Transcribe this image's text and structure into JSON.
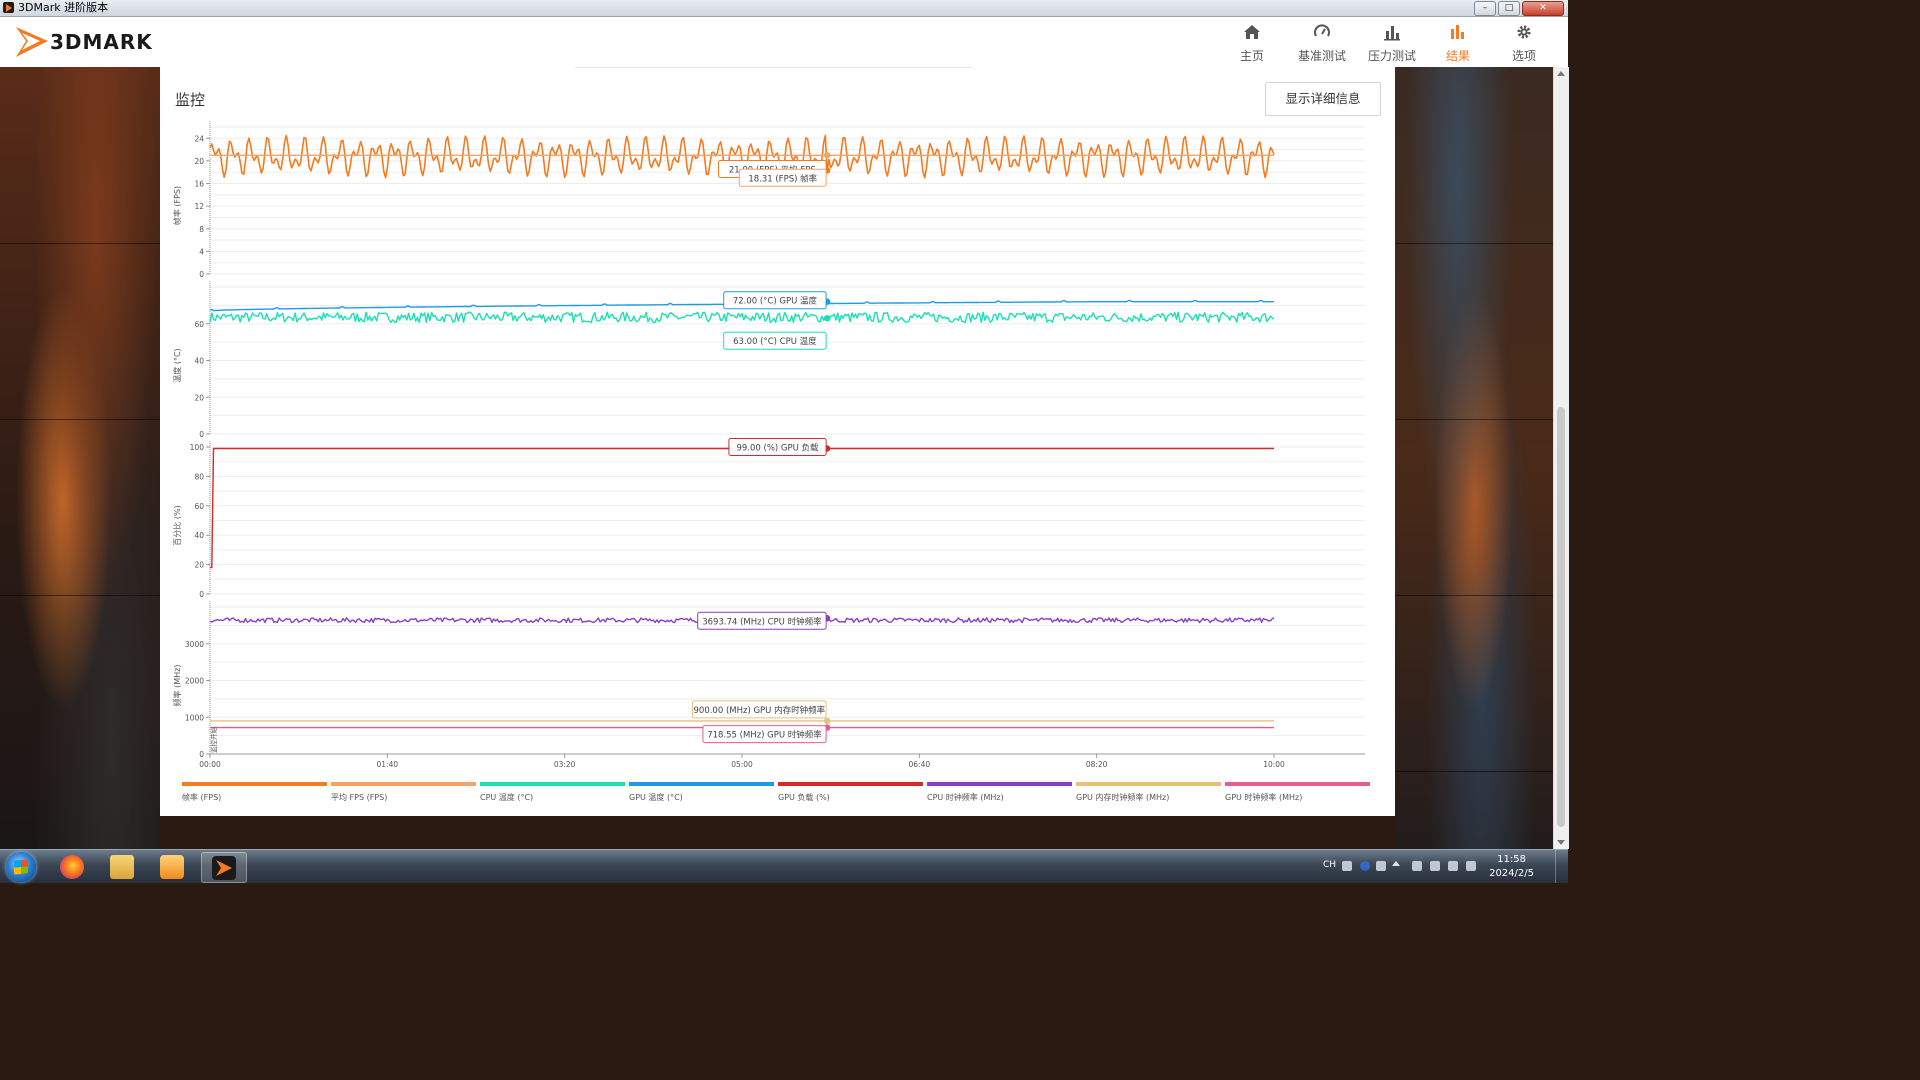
{
  "window": {
    "title": "3DMark 进阶版本",
    "buttons": [
      "–",
      "□",
      "✕"
    ]
  },
  "header": {
    "logo_text": "3DMARK",
    "nav": [
      {
        "label": "主页",
        "icon": "home-icon"
      },
      {
        "label": "基准测试",
        "icon": "gauge-icon"
      },
      {
        "label": "压力测试",
        "icon": "bar-chart-icon"
      },
      {
        "label": "结果",
        "icon": "results-icon",
        "active": true
      },
      {
        "label": "选项",
        "icon": "gear-icon"
      }
    ],
    "accent_color": "#f47b20"
  },
  "panel": {
    "section_title": "监控",
    "details_button": "显示详细信息"
  },
  "chart_data": {
    "type": "line",
    "title": "",
    "x": {
      "ticks": [
        "00:00",
        "01:40",
        "03:20",
        "05:00",
        "06:40",
        "08:20",
        "10:00"
      ],
      "range_seconds": [
        0,
        600
      ]
    },
    "cursor_time": "05:48",
    "panels": [
      {
        "ylabel": "帧率 (FPS)",
        "ylim": [
          0,
          26
        ],
        "yticks": [
          "0",
          "4",
          "8",
          "12",
          "16",
          "20",
          "24"
        ],
        "series": [
          {
            "name": "帧率 (FPS)",
            "color": "#f47b20",
            "pattern": "oscillating",
            "min": 17,
            "max": 24.5,
            "cursor_value": 18.31
          },
          {
            "name": "平均 FPS (FPS)",
            "color": "#f6a36b",
            "pattern": "flat",
            "value": 21.0
          }
        ],
        "tooltips": [
          "21.00 (FPS) 平均 FPS",
          "18.31 (FPS) 帧率"
        ]
      },
      {
        "ylabel": "温度 (°C)",
        "ylim": [
          0,
          80
        ],
        "yticks": [
          "0",
          "20",
          "40",
          "60"
        ],
        "series": [
          {
            "name": "GPU 温度 (°C)",
            "color": "#1e9be8",
            "pattern": "rising",
            "start": 67,
            "end": 72,
            "cursor_value": 72.0
          },
          {
            "name": "CPU 温度 (°C)",
            "color": "#19e0b4",
            "pattern": "noisy",
            "min": 60,
            "max": 67,
            "cursor_value": 63.0
          }
        ],
        "tooltips": [
          "72.00 (°C) GPU 温度",
          "63.00 (°C) CPU 温度"
        ]
      },
      {
        "ylabel": "百分比 (%)",
        "ylim": [
          0,
          100
        ],
        "yticks": [
          "0",
          "20",
          "40",
          "60",
          "80",
          "100"
        ],
        "series": [
          {
            "name": "GPU 负载 (%)",
            "color": "#d22b2b",
            "pattern": "step",
            "start": 18,
            "value": 99,
            "cursor_value": 99.0
          }
        ],
        "tooltips": [
          "99.00 (%) GPU 负载"
        ]
      },
      {
        "ylabel": "频率 (MHz)",
        "ylim": [
          0,
          4000
        ],
        "yticks": [
          "0",
          "1000",
          "2000",
          "3000"
        ],
        "series": [
          {
            "name": "CPU 时钟频率 (MHz)",
            "color": "#8a3fc4",
            "pattern": "noisy",
            "min": 3560,
            "max": 3720,
            "cursor_value": 3693.74
          },
          {
            "name": "GPU 内存时钟频率 (MHz)",
            "color": "#e8c07a",
            "pattern": "flat",
            "value": 900.0
          },
          {
            "name": "GPU 时钟频率 (MHz)",
            "color": "#e65c8e",
            "pattern": "flat",
            "value": 718.55
          }
        ],
        "tooltips": [
          "3693.74 (MHz) CPU 时钟频率",
          "900.00 (MHz) GPU 内存时钟频率",
          "718.55 (MHz) GPU 时钟频率"
        ],
        "marker_label": "监控开始"
      }
    ],
    "legend": [
      {
        "name": "帧率 (FPS)",
        "color": "#f47b20"
      },
      {
        "name": "平均 FPS (FPS)",
        "color": "#f6a36b"
      },
      {
        "name": "CPU 温度 (°C)",
        "color": "#19e0b4"
      },
      {
        "name": "GPU 温度 (°C)",
        "color": "#1e9be8"
      },
      {
        "name": "GPU 负载 (%)",
        "color": "#d22b2b"
      },
      {
        "name": "CPU 时钟频率 (MHz)",
        "color": "#8a3fc4"
      },
      {
        "name": "GPU 内存时钟频率 (MHz)",
        "color": "#e8c07a"
      },
      {
        "name": "GPU 时钟频率 (MHz)",
        "color": "#e65c8e"
      }
    ],
    "legend_position": "bottom"
  },
  "taskbar": {
    "apps": [
      "firefox-icon",
      "file-explorer-icon",
      "media-player-icon",
      "3dmark-icon"
    ],
    "active_app": "3dmark-icon",
    "language": "CH",
    "time": "11:58",
    "date": "2024/2/5"
  }
}
